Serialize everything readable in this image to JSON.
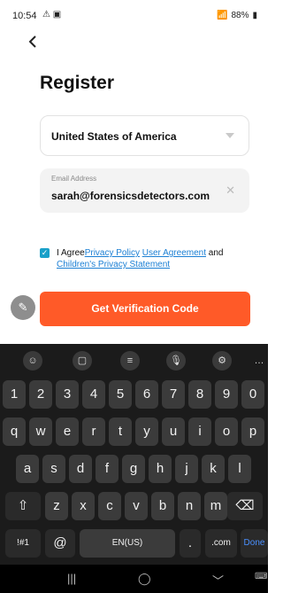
{
  "status": {
    "time": "10:54",
    "left_icons": "⚠ ▣",
    "battery": "88%"
  },
  "header": {
    "back_icon": "chevron-left-icon"
  },
  "page": {
    "title": "Register"
  },
  "country": {
    "value": "United States of America"
  },
  "email": {
    "label": "Email Address",
    "value": "sarah@forensicsdetectors.com"
  },
  "agreement": {
    "prefix": "I Agree",
    "privacy_policy": "Privacy Policy",
    "user_agreement": "User Agreement",
    "and": "and",
    "children_privacy": "Children's Privacy Statement"
  },
  "button": {
    "get_code": "Get Verification Code"
  },
  "keyboard": {
    "row1": [
      "1",
      "2",
      "3",
      "4",
      "5",
      "6",
      "7",
      "8",
      "9",
      "0"
    ],
    "row2": [
      "q",
      "w",
      "e",
      "r",
      "t",
      "y",
      "u",
      "i",
      "o",
      "p"
    ],
    "row3": [
      "a",
      "s",
      "d",
      "f",
      "g",
      "h",
      "j",
      "k",
      "l"
    ],
    "row4": [
      "z",
      "x",
      "c",
      "v",
      "b",
      "n",
      "m"
    ],
    "bottom": {
      "sym": "!#1",
      "at": "@",
      "space": "EN(US)",
      "dot": ".",
      "com": ".com",
      "done": "Done"
    }
  }
}
